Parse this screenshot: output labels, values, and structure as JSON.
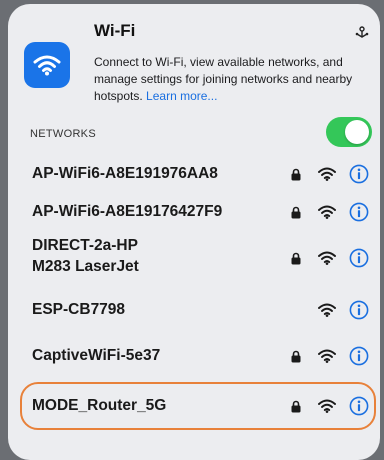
{
  "panel": {
    "title": "Wi-Fi",
    "description": "Connect to Wi-Fi, view available networks, and manage settings for joining networks and nearby hotspots.",
    "learn_more": "Learn more...",
    "section_label": "NETWORKS",
    "wifi_enabled": true
  },
  "networks": [
    {
      "line1": "AP-WiFi6-A8E191976AA8",
      "line2": "",
      "secured": true
    },
    {
      "line1": "AP-WiFi6-A8E19176427F9",
      "line2": "",
      "secured": true
    },
    {
      "line1": "DIRECT-2a-HP",
      "line2": "M283 LaserJet",
      "secured": true
    },
    {
      "line1": "ESP-CB7798",
      "line2": "",
      "secured": false
    },
    {
      "line1": "CaptiveWiFi-5e37",
      "line2": "",
      "secured": true
    },
    {
      "line1": "MODE_Router_5G",
      "line2": "",
      "secured": true
    }
  ],
  "colors": {
    "accent": "#1a74e8",
    "toggle_on": "#34c759",
    "highlight": "#e8813a",
    "info": "#1a6fe0"
  },
  "icons": {
    "app": "wifi-icon",
    "settings": "settings-icon",
    "lock": "lock-icon",
    "signal": "wifi-signal-icon",
    "info": "info-icon"
  }
}
